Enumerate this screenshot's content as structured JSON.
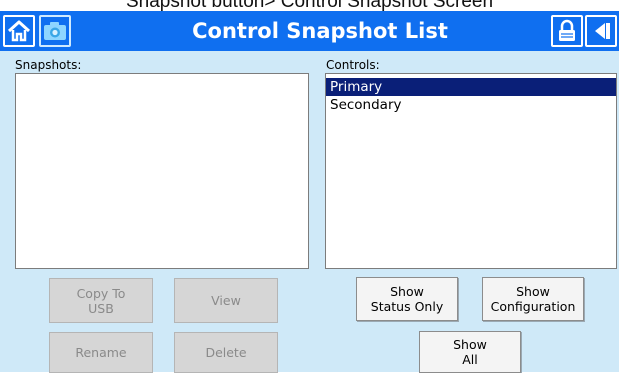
{
  "caption": "Snapshot button> Control Snapshot Screen",
  "header": {
    "title": "Control Snapshot List",
    "icons": [
      "home-icon",
      "camera-icon",
      "lock-icon",
      "back-icon"
    ]
  },
  "snapshots": {
    "label": "Snapshots:",
    "items": []
  },
  "controls": {
    "label": "Controls:",
    "items": [
      {
        "label": "Primary",
        "selected": true
      },
      {
        "label": "Secondary",
        "selected": false
      }
    ]
  },
  "buttons": {
    "copy_to_usb": "Copy To\nUSB",
    "view": "View",
    "rename": "Rename",
    "delete": "Delete",
    "show_status_only": "Show\nStatus Only",
    "show_configuration": "Show\nConfiguration",
    "show_all": "Show\nAll"
  },
  "colors": {
    "header_bg": "#0f6ff0",
    "content_bg": "#cfe9f8",
    "selection_bg": "#0a1f78"
  }
}
